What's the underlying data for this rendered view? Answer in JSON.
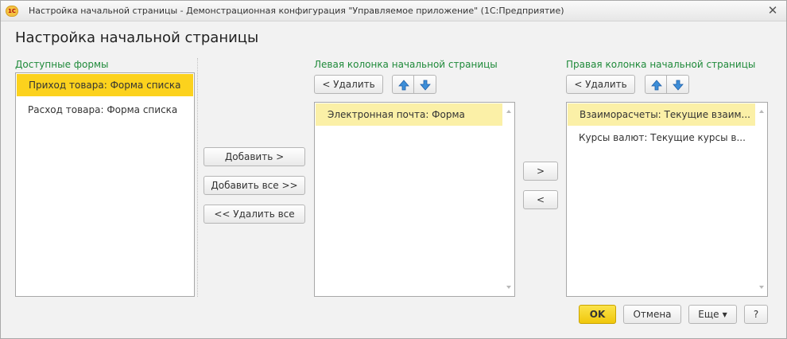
{
  "window": {
    "title": "Настройка начальной страницы - Демонстрационная конфигурация \"Управляемое приложение\"  (1С:Предприятие)",
    "logo_text": "1С"
  },
  "form": {
    "title": "Настройка начальной страницы"
  },
  "available": {
    "label": "Доступные формы",
    "items": [
      "Приход товара: Форма списка",
      "Расход товара: Форма списка"
    ]
  },
  "middle_buttons": {
    "add": "Добавить >",
    "add_all": "Добавить все >>",
    "remove_all": "<< Удалить все"
  },
  "left_column": {
    "label": "Левая колонка начальной страницы",
    "delete_label": "< Удалить",
    "items": [
      "Электронная почта: Форма"
    ]
  },
  "move_buttons": {
    "right": ">",
    "left": "<"
  },
  "right_column": {
    "label": "Правая колонка начальной страницы",
    "delete_label": "< Удалить",
    "items": [
      "Взаиморасчеты: Текущие взаим...",
      "Курсы валют: Текущие курсы в..."
    ]
  },
  "footer": {
    "ok": "OK",
    "cancel": "Отмена",
    "more": "Еще",
    "help": "?"
  },
  "colors": {
    "accent_green": "#1f8a3a",
    "selection_strong": "#fcd21d",
    "selection_soft": "#fbf0a7",
    "arrow_blue": "#3d8ed8",
    "ok_yellow": "#f5d11c"
  },
  "icons": [
    "app-logo-icon",
    "close-icon",
    "arrow-up-icon",
    "arrow-down-icon",
    "dropdown-caret-icon"
  ]
}
